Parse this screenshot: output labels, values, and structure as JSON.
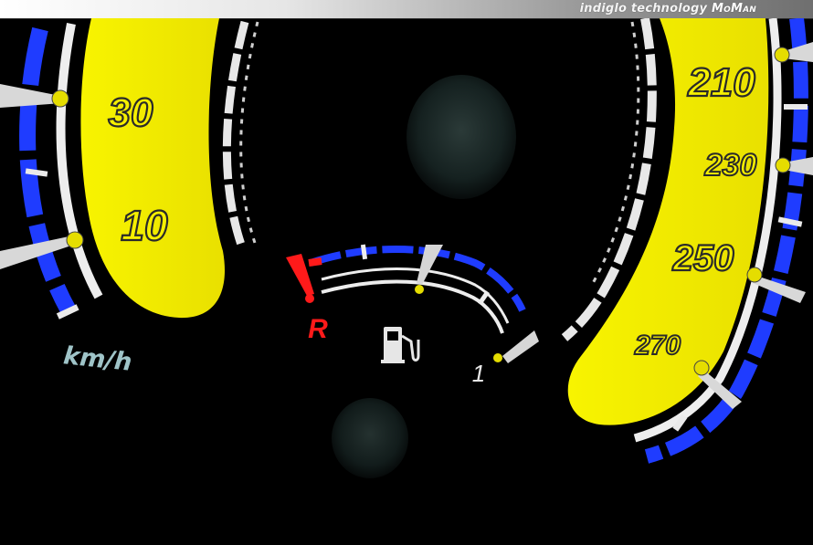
{
  "brand": {
    "prefix": "indiglo technology",
    "name": "MoMan"
  },
  "left_gauge": {
    "labels": [
      "30",
      "10"
    ],
    "unit": "km/h"
  },
  "right_gauge": {
    "labels": [
      "210",
      "230",
      "250",
      "270"
    ]
  },
  "fuel_gauge": {
    "reserve_label": "R",
    "full_label": "1",
    "icon": "fuel-pump-icon"
  },
  "colors": {
    "dial_yellow": "#f6f000",
    "scale_blue": "#1f3cff",
    "warning_red": "#ff1a1a",
    "tick_white": "#f2f2f2"
  }
}
